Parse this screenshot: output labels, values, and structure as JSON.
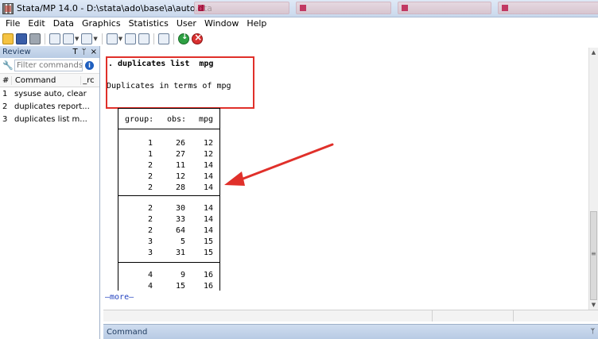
{
  "window": {
    "title": "Stata/MP 14.0 - D:\\stata\\ado\\base\\a\\auto.dta"
  },
  "menu": [
    "File",
    "Edit",
    "Data",
    "Graphics",
    "Statistics",
    "User",
    "Window",
    "Help"
  ],
  "review": {
    "title": "Review",
    "controls": [
      "T",
      "ᛘ",
      "×"
    ],
    "filter_placeholder": "Filter commands he",
    "columns": {
      "num": "#",
      "command": "Command",
      "rc": "_rc"
    },
    "history": [
      {
        "num": "1",
        "command": "sysuse auto, clear"
      },
      {
        "num": "2",
        "command": "duplicates report..."
      },
      {
        "num": "3",
        "command": "duplicates list  m..."
      }
    ]
  },
  "results": {
    "command_line": ". duplicates list  mpg",
    "heading": "Duplicates in terms of mpg",
    "headers": {
      "group": "group:",
      "obs": "obs:",
      "mpg": "mpg"
    },
    "rows": [
      {
        "group": "1",
        "obs": "26",
        "mpg": "12"
      },
      {
        "group": "1",
        "obs": "27",
        "mpg": "12"
      },
      {
        "group": "2",
        "obs": "11",
        "mpg": "14"
      },
      {
        "group": "2",
        "obs": "12",
        "mpg": "14"
      },
      {
        "group": "2",
        "obs": "28",
        "mpg": "14"
      },
      {
        "group": "2",
        "obs": "30",
        "mpg": "14"
      },
      {
        "group": "2",
        "obs": "33",
        "mpg": "14"
      },
      {
        "group": "2",
        "obs": "64",
        "mpg": "14"
      },
      {
        "group": "3",
        "obs": "5",
        "mpg": "15"
      },
      {
        "group": "3",
        "obs": "31",
        "mpg": "15"
      },
      {
        "group": "4",
        "obs": "9",
        "mpg": "16"
      },
      {
        "group": "4",
        "obs": "15",
        "mpg": "16"
      }
    ],
    "more": "—more—"
  },
  "command_pane": {
    "title": "Command",
    "pin": "ᛘ"
  },
  "colors": {
    "highlight": "#e0302a",
    "pane_header": "#c7d7ec",
    "more_link": "#1f3fbf"
  },
  "icons": [
    "open-icon",
    "save-icon",
    "print-icon",
    "log-icon",
    "viewer-icon",
    "graph-icon",
    "do-file-editor-icon",
    "data-editor-icon",
    "data-browser-icon",
    "variables-manager-icon",
    "clear-more-icon",
    "break-icon"
  ]
}
